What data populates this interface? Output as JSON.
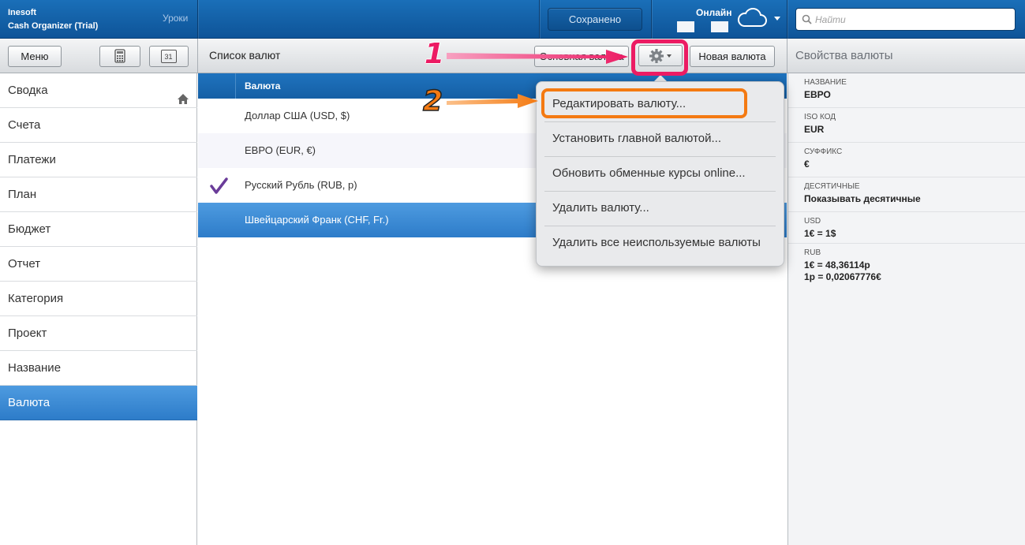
{
  "app": {
    "vendor": "Inesoft",
    "name": "Cash Organizer (Trial)",
    "lessons_label": "Уроки"
  },
  "header": {
    "saved_label": "Сохранено",
    "online_label": "Онлайн",
    "search_placeholder": "Найти",
    "icons": [
      "cloud-icon",
      "search-icon",
      "chevron-down-icon"
    ]
  },
  "toolbar": {
    "menu_label": "Меню",
    "calendar_day": "31",
    "list_title": "Список валют",
    "hidden_button_label": "Основная валюта",
    "new_currency_label": "Новая валюта",
    "props_title": "Свойства валюты"
  },
  "sidebar": {
    "items": [
      {
        "label": "Сводка"
      },
      {
        "label": "Счета"
      },
      {
        "label": "Платежи"
      },
      {
        "label": "План"
      },
      {
        "label": "Бюджет"
      },
      {
        "label": "Отчет"
      },
      {
        "label": "Категория"
      },
      {
        "label": "Проект"
      },
      {
        "label": "Название"
      },
      {
        "label": "Валюта"
      }
    ],
    "active": "Валюта"
  },
  "currency_list": {
    "column_header": "Валюта",
    "rows": [
      {
        "name": "Доллар США (USD, $)",
        "main": false
      },
      {
        "name": "ЕВРО (EUR, €)",
        "main": false
      },
      {
        "name": "Русский Рубль (RUB, р)",
        "main": true
      },
      {
        "name": "Швейцарский Франк (CHF, Fr.)",
        "main": false
      }
    ],
    "selected": "Швейцарский Франк (CHF, Fr.)"
  },
  "context_menu": {
    "items": [
      {
        "label": "Редактировать валюту..."
      },
      {
        "label": "Установить главной валютой..."
      },
      {
        "label": "Обновить обменные курсы online..."
      },
      {
        "label": "Удалить валюту..."
      },
      {
        "label": "Удалить все неиспользуемые валюты"
      }
    ]
  },
  "properties": {
    "fields": [
      {
        "key": "НАЗВАНИЕ",
        "value": "ЕВРО"
      },
      {
        "key": "ISO КОД",
        "value": "EUR"
      },
      {
        "key": "СУФФИКС",
        "value": "€"
      },
      {
        "key": "ДЕСЯТИЧНЫЕ",
        "value": "Показывать десятичные"
      },
      {
        "key": "USD",
        "value": "1€ = 1$"
      },
      {
        "key": "RUB",
        "value": "1€ = 48,36114р",
        "value2": "1р = 0,02067776€"
      }
    ]
  },
  "annotations": {
    "step1": "1",
    "step2": "2",
    "colors": {
      "step1": "#ec1b63",
      "step2": "#f47a12"
    }
  }
}
